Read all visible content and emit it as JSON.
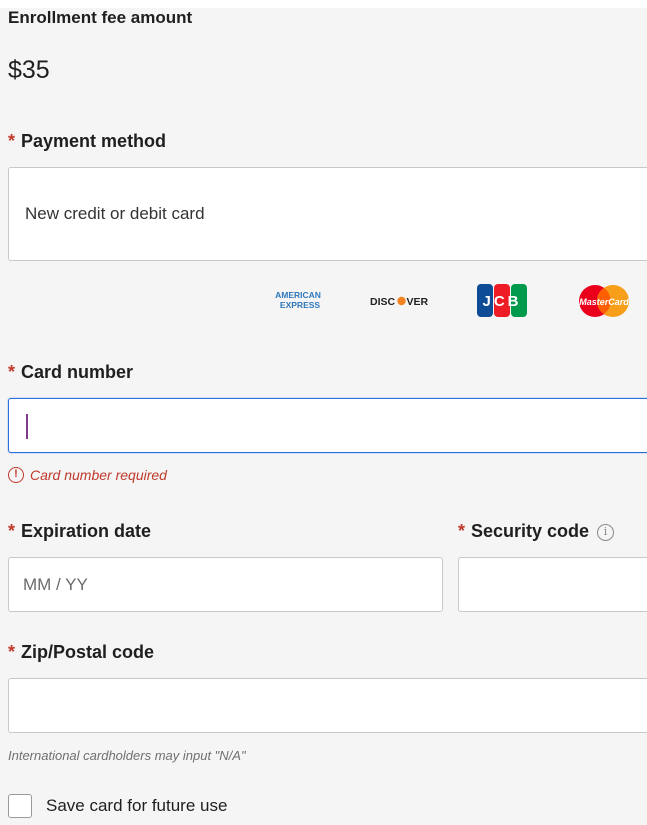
{
  "enrollment": {
    "fee_label": "Enrollment fee amount",
    "fee_amount": "$35"
  },
  "payment_method": {
    "label": "Payment method",
    "required_mark": "*",
    "selected": "New credit or debit card",
    "card_brands": [
      {
        "name": "American Express",
        "text_line1": "AMERICAN",
        "text_line2": "EXPRESS"
      },
      {
        "name": "Discover",
        "text_a": "DISC",
        "text_b": "VER"
      },
      {
        "name": "JCB",
        "text": "JCB"
      },
      {
        "name": "MasterCard",
        "text": "MasterCard"
      }
    ]
  },
  "card_number": {
    "label": "Card number",
    "required_mark": "*",
    "value": "",
    "placeholder": "",
    "error": "Card number required",
    "error_icon_glyph": "!"
  },
  "expiration": {
    "label": "Expiration date",
    "required_mark": "*",
    "placeholder": "MM / YY"
  },
  "security_code": {
    "label": "Security code",
    "required_mark": "*",
    "info_glyph": "i"
  },
  "zip": {
    "label": "Zip/Postal code",
    "required_mark": "*",
    "hint": "International cardholders may input \"N/A\""
  },
  "save_card": {
    "label": "Save card for future use",
    "checked": false
  },
  "colors": {
    "required": "#c0392b",
    "focus_border": "#2b6ee0",
    "amex_blue": "#2e77bc",
    "discover_orange": "#f58220",
    "jcb_blue": "#0e4c96",
    "jcb_red": "#ee1c25",
    "jcb_green": "#009a4d",
    "mc_red": "#eb001b",
    "mc_yellow": "#f79e1b"
  }
}
